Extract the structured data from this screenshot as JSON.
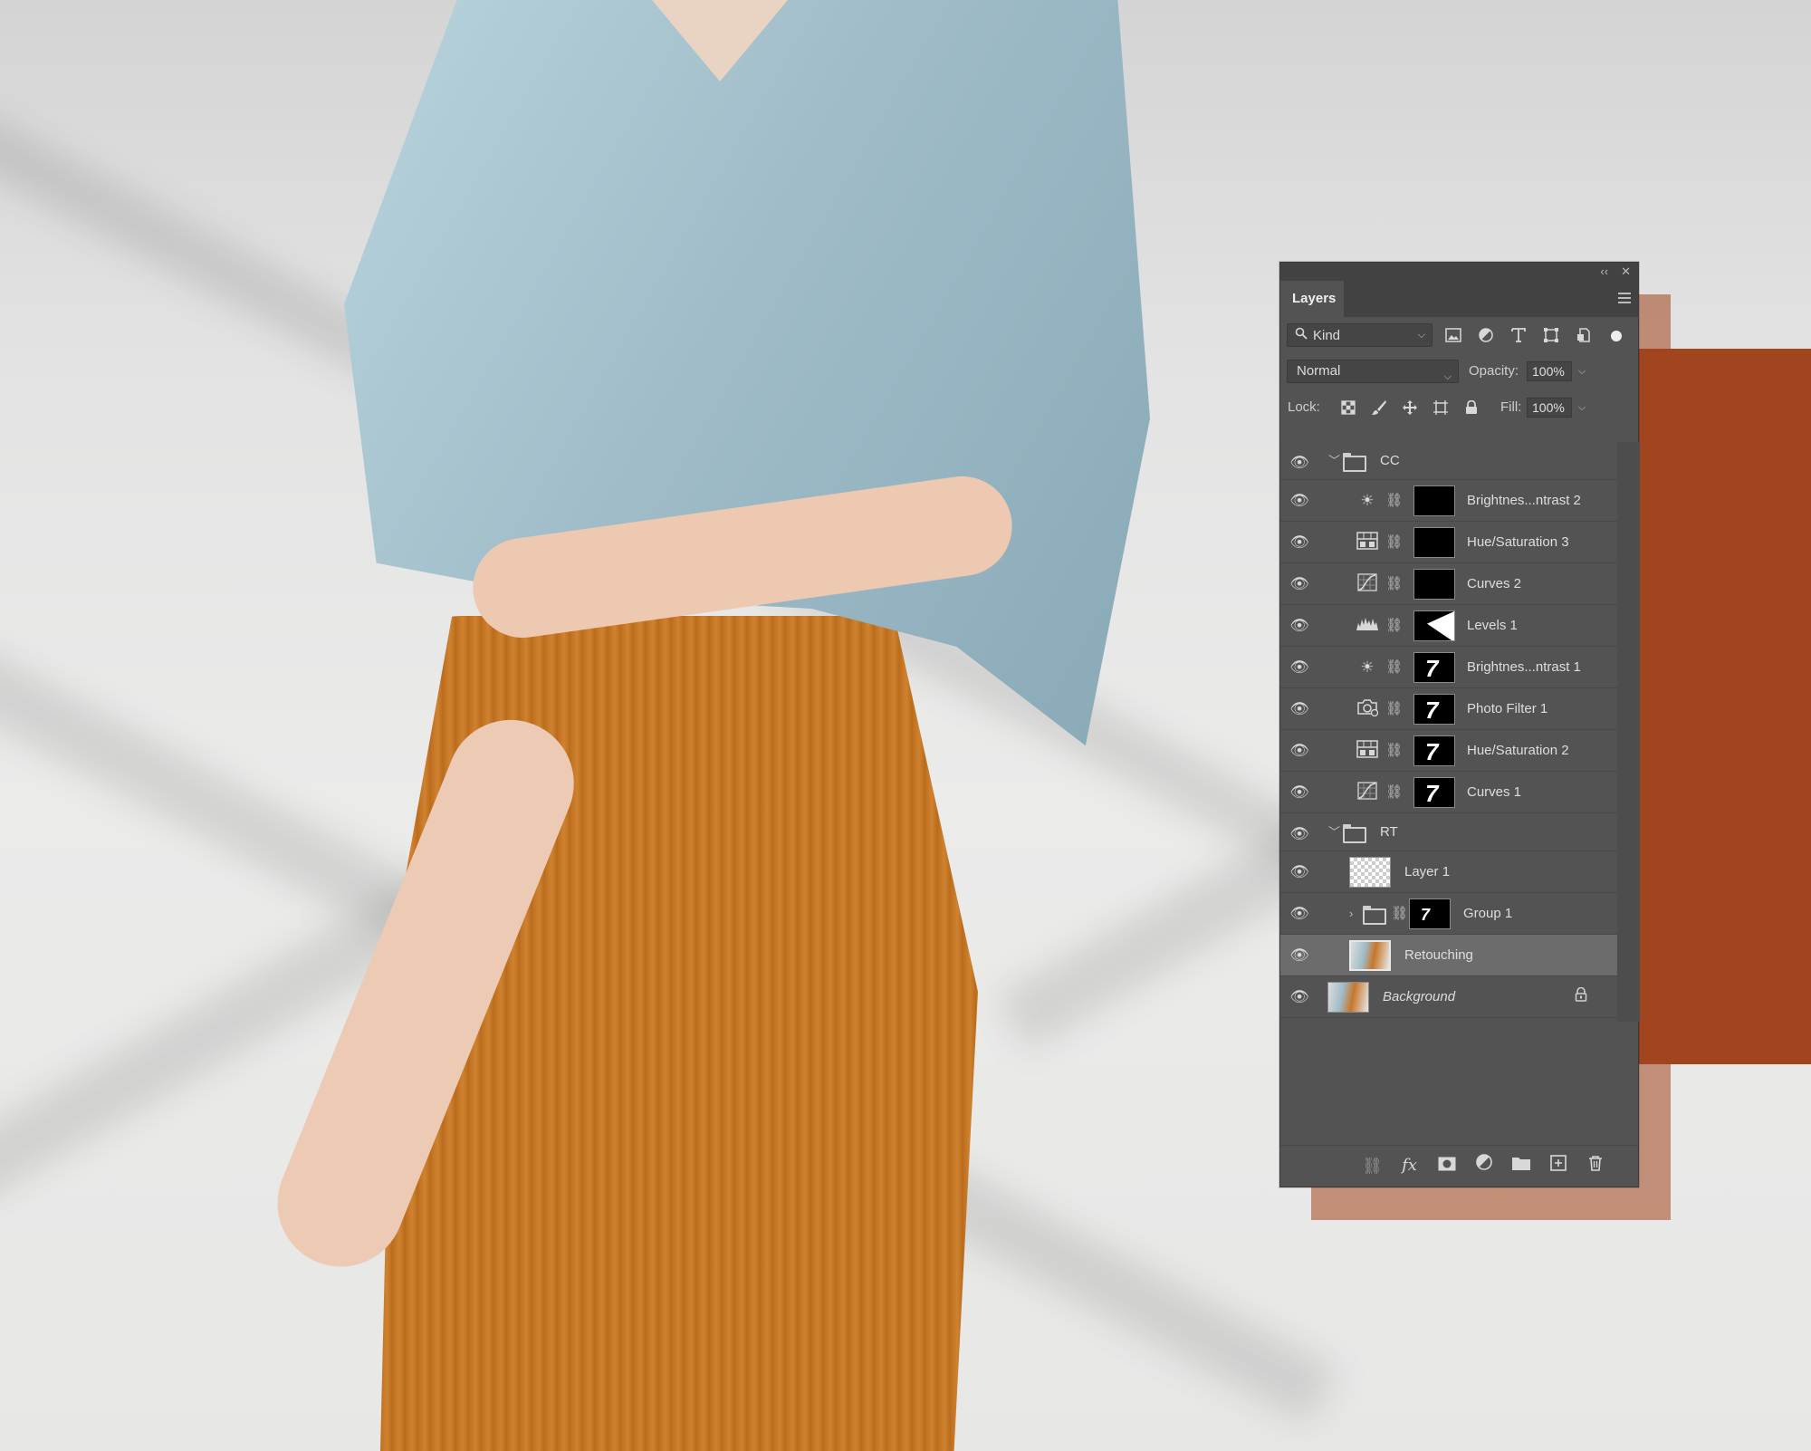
{
  "panel": {
    "collapse_glyph": "‹‹",
    "close_glyph": "✕",
    "tab_label": "Layers",
    "menu_icon": "hamburger-icon"
  },
  "filter": {
    "kind_label": "Kind",
    "icons": [
      "image-filter-icon",
      "adjustment-filter-icon",
      "type-filter-icon",
      "shape-filter-icon",
      "smart-object-filter-icon"
    ]
  },
  "blend": {
    "mode": "Normal",
    "opacity_label": "Opacity:",
    "opacity_value": "100%"
  },
  "lock": {
    "label": "Lock:",
    "fill_label": "Fill:",
    "fill_value": "100%"
  },
  "layers": [
    {
      "type": "group",
      "name": "CC",
      "expanded": true
    },
    {
      "type": "adjustment",
      "name": "Brightnes...ntrast 2",
      "icon": "sun-icon",
      "mask": "black"
    },
    {
      "type": "adjustment",
      "name": "Hue/Saturation 3",
      "icon": "hue-saturation-icon",
      "mask": "black"
    },
    {
      "type": "adjustment",
      "name": "Curves 2",
      "icon": "curves-icon",
      "mask": "black"
    },
    {
      "type": "adjustment",
      "name": "Levels 1",
      "icon": "levels-icon",
      "mask": "levels"
    },
    {
      "type": "adjustment",
      "name": "Brightnes...ntrast 1",
      "icon": "sun-icon",
      "mask": "figure"
    },
    {
      "type": "adjustment",
      "name": "Photo Filter 1",
      "icon": "camera-icon",
      "mask": "figure"
    },
    {
      "type": "adjustment",
      "name": "Hue/Saturation 2",
      "icon": "hue-saturation-icon",
      "mask": "figure"
    },
    {
      "type": "adjustment",
      "name": "Curves 1",
      "icon": "curves-icon",
      "mask": "figure"
    },
    {
      "type": "group",
      "name": "RT",
      "expanded": true
    },
    {
      "type": "pixel",
      "name": "Layer 1",
      "thumb": "transparent"
    },
    {
      "type": "group",
      "name": "Group 1",
      "expanded": false,
      "mask": "figure"
    },
    {
      "type": "pixel",
      "name": "Retouching",
      "thumb": "photo",
      "selected": true
    },
    {
      "type": "background",
      "name": "Background",
      "thumb": "photo",
      "locked": true
    }
  ],
  "bottom_icons": [
    "link-layers-icon",
    "fx-icon",
    "add-mask-icon",
    "adjustment-layer-icon",
    "new-group-icon",
    "new-layer-icon",
    "trash-icon"
  ],
  "colors": {
    "panel_bg": "#535353",
    "panel_header": "#424242",
    "selected_row": "#6c6c6c",
    "accent_orange": "#a0451d"
  }
}
